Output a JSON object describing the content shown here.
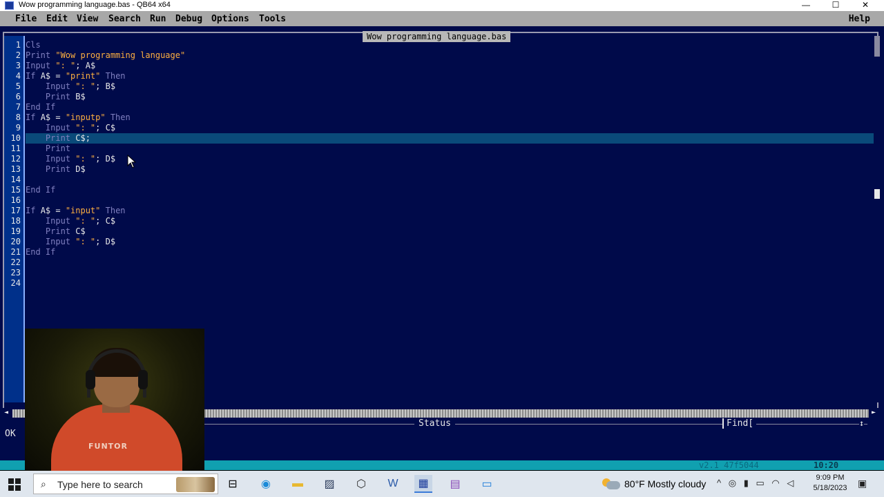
{
  "window": {
    "title": "Wow programming language.bas - QB64 x64",
    "minimize_glyph": "—",
    "maximize_glyph": "☐",
    "close_glyph": "✕"
  },
  "menu": {
    "items": [
      "File",
      "Edit",
      "View",
      "Search",
      "Run",
      "Debug",
      "Options",
      "Tools"
    ],
    "help": "Help"
  },
  "editor": {
    "file_tab": "Wow programming language.bas",
    "highlighted_line": 10,
    "lines": [
      {
        "n": "1",
        "tokens": [
          {
            "t": "kw",
            "v": "Cls"
          }
        ]
      },
      {
        "n": "2",
        "tokens": [
          {
            "t": "kw",
            "v": "Print "
          },
          {
            "t": "st",
            "v": "\"Wow programming language\""
          }
        ]
      },
      {
        "n": "3",
        "tokens": [
          {
            "t": "kw",
            "v": "Input "
          },
          {
            "t": "st",
            "v": "\": \""
          },
          {
            "t": "tx",
            "v": "; A$"
          }
        ]
      },
      {
        "n": "4",
        "tokens": [
          {
            "t": "kw",
            "v": "If "
          },
          {
            "t": "tx",
            "v": "A$ = "
          },
          {
            "t": "st",
            "v": "\"print\""
          },
          {
            "t": "kw",
            "v": " Then"
          }
        ]
      },
      {
        "n": "5",
        "tokens": [
          {
            "t": "kw",
            "v": "    Input "
          },
          {
            "t": "st",
            "v": "\": \""
          },
          {
            "t": "tx",
            "v": "; B$"
          }
        ]
      },
      {
        "n": "6",
        "tokens": [
          {
            "t": "kw",
            "v": "    Print "
          },
          {
            "t": "tx",
            "v": "B$"
          }
        ]
      },
      {
        "n": "7",
        "tokens": [
          {
            "t": "kw",
            "v": "End If"
          }
        ]
      },
      {
        "n": "8",
        "tokens": [
          {
            "t": "kw",
            "v": "If "
          },
          {
            "t": "tx",
            "v": "A$ = "
          },
          {
            "t": "st",
            "v": "\"inputp\""
          },
          {
            "t": "kw",
            "v": " Then"
          }
        ]
      },
      {
        "n": "9",
        "tokens": [
          {
            "t": "kw",
            "v": "    Input "
          },
          {
            "t": "st",
            "v": "\": \""
          },
          {
            "t": "tx",
            "v": "; C$"
          }
        ]
      },
      {
        "n": "10",
        "tokens": [
          {
            "t": "kw",
            "v": "    Print "
          },
          {
            "t": "tx",
            "v": "C$;"
          }
        ]
      },
      {
        "n": "11",
        "tokens": [
          {
            "t": "kw",
            "v": "    Print"
          }
        ]
      },
      {
        "n": "12",
        "tokens": [
          {
            "t": "kw",
            "v": "    Input "
          },
          {
            "t": "st",
            "v": "\": \""
          },
          {
            "t": "tx",
            "v": "; D$"
          }
        ]
      },
      {
        "n": "13",
        "tokens": [
          {
            "t": "kw",
            "v": "    Print "
          },
          {
            "t": "tx",
            "v": "D$"
          }
        ]
      },
      {
        "n": "14",
        "tokens": []
      },
      {
        "n": "15",
        "tokens": [
          {
            "t": "kw",
            "v": "End If"
          }
        ]
      },
      {
        "n": "16",
        "tokens": []
      },
      {
        "n": "17",
        "tokens": [
          {
            "t": "kw",
            "v": "If "
          },
          {
            "t": "tx",
            "v": "A$ = "
          },
          {
            "t": "st",
            "v": "\"input\""
          },
          {
            "t": "kw",
            "v": " Then"
          }
        ]
      },
      {
        "n": "18",
        "tokens": [
          {
            "t": "kw",
            "v": "    Input "
          },
          {
            "t": "st",
            "v": "\": \""
          },
          {
            "t": "tx",
            "v": "; C$"
          }
        ]
      },
      {
        "n": "19",
        "tokens": [
          {
            "t": "kw",
            "v": "    Print "
          },
          {
            "t": "tx",
            "v": "C$"
          }
        ]
      },
      {
        "n": "20",
        "tokens": [
          {
            "t": "kw",
            "v": "    Input "
          },
          {
            "t": "st",
            "v": "\": \""
          },
          {
            "t": "tx",
            "v": "; D$"
          }
        ]
      },
      {
        "n": "21",
        "tokens": [
          {
            "t": "kw",
            "v": "End If"
          }
        ]
      },
      {
        "n": "22",
        "tokens": []
      },
      {
        "n": "23",
        "tokens": []
      },
      {
        "n": "24",
        "tokens": []
      }
    ],
    "colors": {
      "keyword": "#8080c0",
      "string": "#ffb040",
      "text": "#e8e8e8",
      "background": "#000a4a"
    }
  },
  "status_panel": {
    "title": "Status",
    "find_label": "Find[",
    "find_end": "↕",
    "message": "OK"
  },
  "status_strip": {
    "version": "v2.1 47f5044",
    "position": "10:20"
  },
  "webcam": {
    "shirt_text": "FUNTOR"
  },
  "taskbar": {
    "search_placeholder": "Type here to search",
    "weather_temp": "80°F",
    "weather_desc": "Mostly cloudy",
    "time": "9:09 PM",
    "date": "5/18/2023",
    "tray_icons": [
      "chevron-up-icon",
      "meet-icon",
      "microphone-icon",
      "battery-icon",
      "wifi-icon",
      "speaker-icon"
    ],
    "apps": [
      "task-view-icon",
      "edge-icon",
      "file-explorer-icon",
      "app-icon",
      "unity-icon",
      "word-icon",
      "qb64-icon",
      "video-editor-icon",
      "app-window-icon"
    ]
  }
}
